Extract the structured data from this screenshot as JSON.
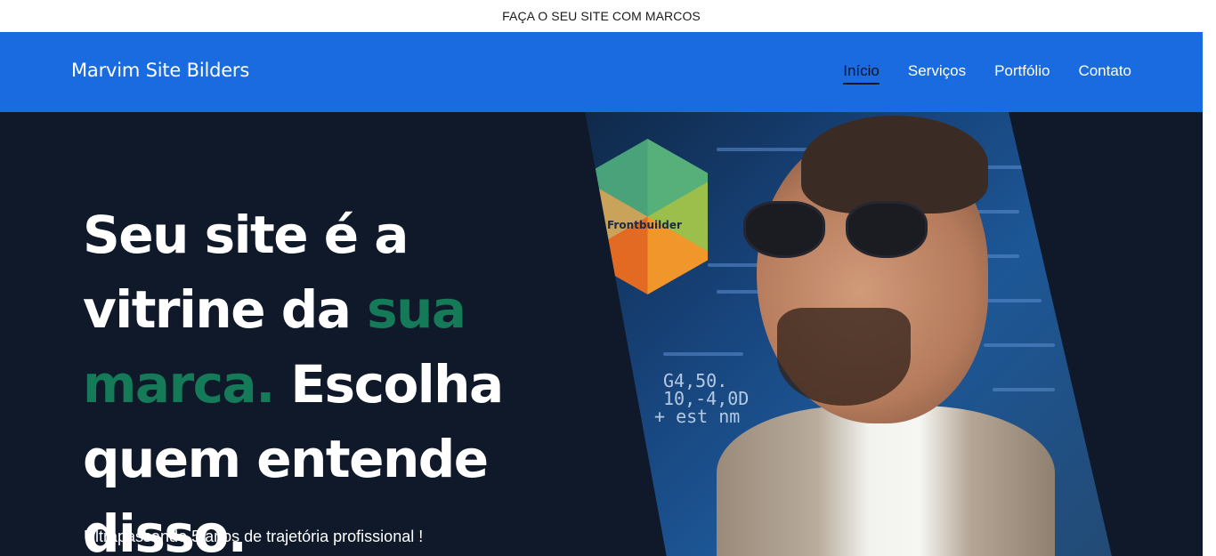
{
  "topbar": {
    "text": "FAÇA O SEU SITE COM MARCOS"
  },
  "header": {
    "brand": "Marvim Site Bilders",
    "nav": [
      {
        "label": "Início",
        "active": true
      },
      {
        "label": "Serviços",
        "active": false
      },
      {
        "label": "Portfólio",
        "active": false
      },
      {
        "label": "Contato",
        "active": false
      }
    ]
  },
  "hero": {
    "title_part1": "Seu site é a vitrine da ",
    "title_accent": "sua marca.",
    "title_part2": " Escolha quem entende disso.",
    "subtitle": "Ultrapassando 5 anos de trajetória profissional !",
    "image_label": "Frontbuilder",
    "code_snippets": [
      "G4,50.",
      "10,-4,0D",
      "+ est nm"
    ]
  },
  "colors": {
    "topbar_bg": "#ffffff",
    "nav_bg": "#1a6be0",
    "hero_bg": "#0f1929",
    "accent": "#157a57"
  }
}
